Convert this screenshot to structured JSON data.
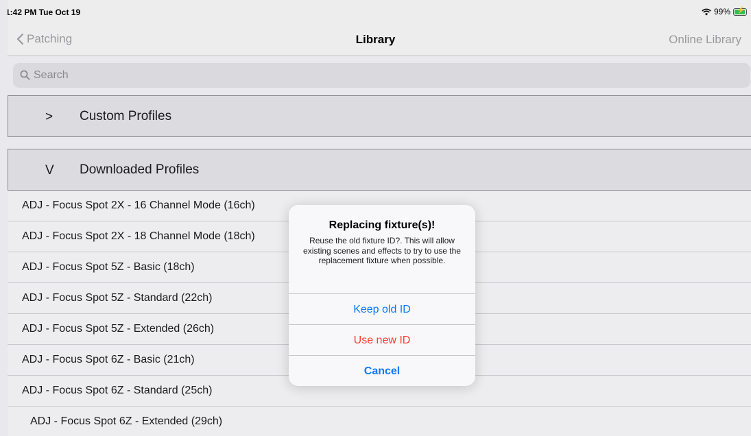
{
  "status_bar": {
    "time": "1:42 PM  Tue Oct 19",
    "battery": "99%",
    "battery_level": 0.99,
    "battery_color": "#34c759"
  },
  "nav": {
    "back_label": "Patching",
    "title": "Library",
    "right_label": "Online Library"
  },
  "search": {
    "placeholder": "Search",
    "value": ""
  },
  "sections": [
    {
      "toggle": ">",
      "label": "Custom Profiles"
    },
    {
      "toggle": "V",
      "label": "Downloaded Profiles"
    }
  ],
  "list_items": [
    "ADJ - Focus Spot 2X - 16 Channel Mode (16ch)",
    "ADJ - Focus Spot 2X - 18 Channel Mode (18ch)",
    "ADJ - Focus Spot 5Z - Basic (18ch)",
    "ADJ - Focus Spot 5Z - Standard (22ch)",
    "ADJ - Focus Spot 5Z - Extended (26ch)",
    "ADJ - Focus Spot 6Z - Basic (21ch)",
    "ADJ - Focus Spot 6Z - Standard (25ch)",
    "ADJ - Focus Spot 6Z - Extended (29ch)"
  ],
  "alert": {
    "title": "Replacing fixture(s)!",
    "message": "Reuse the old fixture ID?. This will allow existing scenes and effects to try to use the replacement fixture when possible.",
    "buttons": {
      "keep": "Keep old ID",
      "new": "Use new ID",
      "cancel": "Cancel"
    }
  },
  "colors": {
    "accent": "#0a7aff",
    "destructive": "#ff3b30"
  },
  "icons": {
    "back": "chevron-left-icon",
    "search": "magnifying-glass-icon",
    "wifi": "wifi-icon",
    "battery": "battery-charging-icon"
  }
}
